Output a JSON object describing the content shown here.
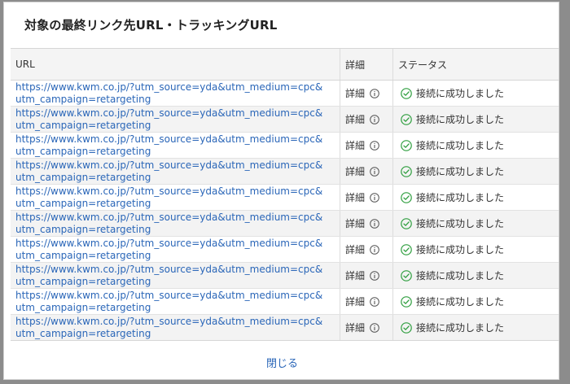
{
  "dialog": {
    "title": "対象の最終リンク先URL・トラッキングURL",
    "close_label": "閉じる"
  },
  "table": {
    "headers": {
      "url": "URL",
      "detail": "詳細",
      "status": "ステータス"
    },
    "rows": [
      {
        "url_line1": "https://www.kwm.co.jp/?utm_source=yda&utm_medium=cpc&",
        "url_line2": "utm_campaign=retargeting",
        "detail": "詳細",
        "status": "接続に成功しました"
      },
      {
        "url_line1": "https://www.kwm.co.jp/?utm_source=yda&utm_medium=cpc&",
        "url_line2": "utm_campaign=retargeting",
        "detail": "詳細",
        "status": "接続に成功しました"
      },
      {
        "url_line1": "https://www.kwm.co.jp/?utm_source=yda&utm_medium=cpc&",
        "url_line2": "utm_campaign=retargeting",
        "detail": "詳細",
        "status": "接続に成功しました"
      },
      {
        "url_line1": "https://www.kwm.co.jp/?utm_source=yda&utm_medium=cpc&",
        "url_line2": "utm_campaign=retargeting",
        "detail": "詳細",
        "status": "接続に成功しました"
      },
      {
        "url_line1": "https://www.kwm.co.jp/?utm_source=yda&utm_medium=cpc&",
        "url_line2": "utm_campaign=retargeting",
        "detail": "詳細",
        "status": "接続に成功しました"
      },
      {
        "url_line1": "https://www.kwm.co.jp/?utm_source=yda&utm_medium=cpc&",
        "url_line2": "utm_campaign=retargeting",
        "detail": "詳細",
        "status": "接続に成功しました"
      },
      {
        "url_line1": "https://www.kwm.co.jp/?utm_source=yda&utm_medium=cpc&",
        "url_line2": "utm_campaign=retargeting",
        "detail": "詳細",
        "status": "接続に成功しました"
      },
      {
        "url_line1": "https://www.kwm.co.jp/?utm_source=yda&utm_medium=cpc&",
        "url_line2": "utm_campaign=retargeting",
        "detail": "詳細",
        "status": "接続に成功しました"
      },
      {
        "url_line1": "https://www.kwm.co.jp/?utm_source=yda&utm_medium=cpc&",
        "url_line2": "utm_campaign=retargeting",
        "detail": "詳細",
        "status": "接続に成功しました"
      },
      {
        "url_line1": "https://www.kwm.co.jp/?utm_source=yda&utm_medium=cpc&",
        "url_line2": "utm_campaign=retargeting",
        "detail": "詳細",
        "status": "接続に成功しました"
      }
    ]
  },
  "icons": {
    "detail_icon": "info-icon",
    "status_icon": "check-circle-icon"
  },
  "colors": {
    "link": "#2a66b8",
    "success": "#2e9e3e"
  }
}
